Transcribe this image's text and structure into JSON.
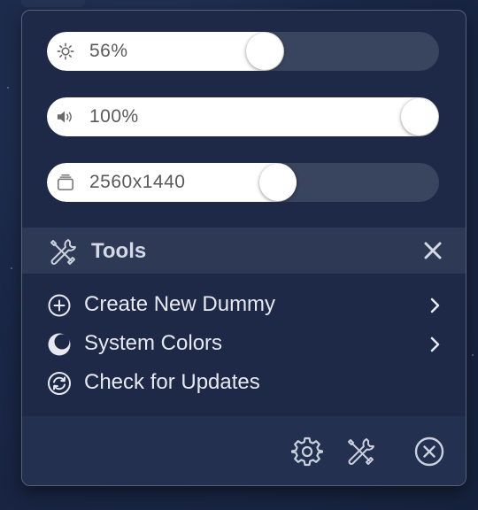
{
  "sliders": {
    "brightness": {
      "label": "56%",
      "icon": "sun-icon",
      "level": 0.56
    },
    "volume": {
      "label": "100%",
      "icon": "speaker-icon",
      "level": 1.0
    },
    "resolution": {
      "label": "2560x1440",
      "icon": "display-stack-icon",
      "level": 0.6
    }
  },
  "tools": {
    "title": "Tools",
    "icon": "tools-icon",
    "close_icon": "close-icon"
  },
  "menu": {
    "items": [
      {
        "label": "Create New Dummy",
        "icon": "plus-circle-icon",
        "has_submenu": true
      },
      {
        "label": "System Colors",
        "icon": "moon-circle-icon",
        "has_submenu": true
      },
      {
        "label": "Check for Updates",
        "icon": "refresh-circle-icon",
        "has_submenu": false
      }
    ]
  },
  "footer": {
    "icons": [
      "settings-gear-icon",
      "tools-icon",
      "quit-circle-x-icon"
    ]
  },
  "colors": {
    "panel_bg": "#1d2947",
    "slider_fill": "#ffffff",
    "slider_track": "#39445f",
    "text": "#e6e9f0"
  }
}
